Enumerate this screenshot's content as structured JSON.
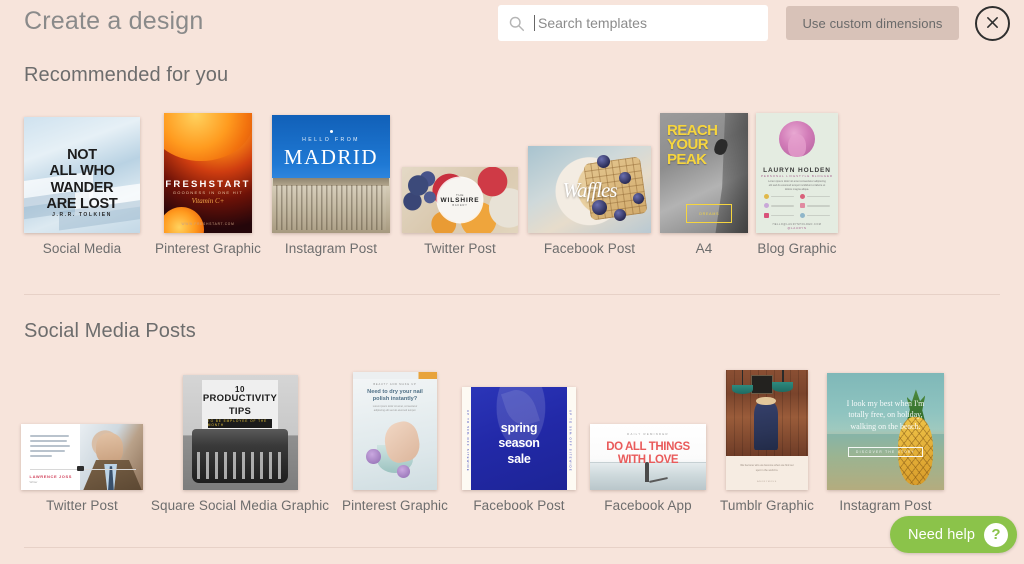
{
  "header": {
    "title": "Create a design",
    "search": {
      "placeholder": "Search templates",
      "value": "",
      "icon": "search-icon"
    },
    "custom_dimensions_label": "Use custom dimensions",
    "close_icon": "close-icon"
  },
  "colors": {
    "background": "#f7e4db",
    "custom_button": "#d8c2b8",
    "need_help_green": "#8bc34a",
    "text": "#6d6d6d",
    "divider": "#e0c9bf"
  },
  "sections": [
    {
      "id": "recommended",
      "title": "Recommended for you",
      "items": [
        {
          "label": "Social Media",
          "art": "snow",
          "text": {
            "line1": "NOT",
            "line2": "ALL WHO",
            "line3": "WANDER",
            "line4": "ARE LOST",
            "credit": "J.R.R. TOLKIEN"
          }
        },
        {
          "label": "Pinterest Graphic",
          "art": "orange",
          "text": {
            "title": "FRESHSTART",
            "subtitle": "GOODNESS IN ONE HIT",
            "script": "Vitamin C+",
            "footer": "WWW.FRESHSTART.COM"
          }
        },
        {
          "label": "Instagram Post",
          "art": "madrid",
          "text": {
            "hello": "HELLO FROM",
            "city": "MADRID"
          }
        },
        {
          "label": "Twitter Post",
          "art": "tarts",
          "text": {
            "badge_top": "THE",
            "badge_main": "WILSHIRE",
            "badge_bottom": "BAKERY"
          }
        },
        {
          "label": "Facebook Post",
          "art": "waffle",
          "text": {
            "word": "Waffles"
          }
        },
        {
          "label": "A4",
          "art": "peak",
          "text": {
            "line1": "REACH",
            "line2": "YOUR",
            "line3": "PEAK",
            "box": "DREAMS"
          }
        },
        {
          "label": "Blog Graphic",
          "art": "resume",
          "text": {
            "name": "LAURYN HOLDEN",
            "role": "PERSONAL LIFESTYLE BLOGGER",
            "paragraph": "Lorem ipsum dolor sit amet consectetur adipiscing elit sed do eiusmod tempor incididunt ut labore et dolore magna aliqua.",
            "footer": "HELLO@LAURYNHOLDEN.COM",
            "footer2": "@LAURYN"
          }
        }
      ]
    },
    {
      "id": "social-media-posts",
      "title": "Social Media Posts",
      "items": [
        {
          "label": "Twitter Post",
          "art": "suit",
          "text": {
            "quote": "When you get to achieving your goals is not as important as what you become by achieving your goals.",
            "name": "LAWRENCE JOSS",
            "sub": "Writer"
          }
        },
        {
          "label": "Square Social Media Graphic",
          "art": "typewriter",
          "text": {
            "number": "10",
            "line1": "PRODUCTIVITY",
            "line2": "TIPS",
            "band": "TO BE EMPLOYEE OF THE MONTH"
          }
        },
        {
          "label": "Pinterest Graphic",
          "art": "nail",
          "text": {
            "kicker": "BEAUTY AND MAKE UP",
            "title": "Need to dry your nail polish instantly?",
            "body": "Lorem ipsum dolor sit amet, consectetur adipiscing elit sed do eiusmod tempor."
          }
        },
        {
          "label": "Facebook Post",
          "art": "spring",
          "text": {
            "line1": "spring",
            "line2": "season",
            "line3": "sale",
            "side": "UP TO 50% OFF SITEWIDE"
          }
        },
        {
          "label": "Facebook App",
          "art": "love",
          "text": {
            "kicker": "DAILY REMINDER",
            "line1": "DO ALL THINGS",
            "line2": "WITH LOVE"
          }
        },
        {
          "label": "Tumblr Graphic",
          "art": "cafe",
          "text": {
            "caption": "We become who we become when we find our spot in the world to.",
            "source": "ANONYMOUS"
          }
        },
        {
          "label": "Instagram Post",
          "art": "pineapple",
          "text": {
            "quote": "I look my best when I'm totally free, on holiday, walking on the beach.",
            "button": "DISCOVER THE STORY"
          }
        }
      ]
    }
  ],
  "need_help": {
    "label": "Need help",
    "badge": "?",
    "icon": "question-mark-icon"
  }
}
